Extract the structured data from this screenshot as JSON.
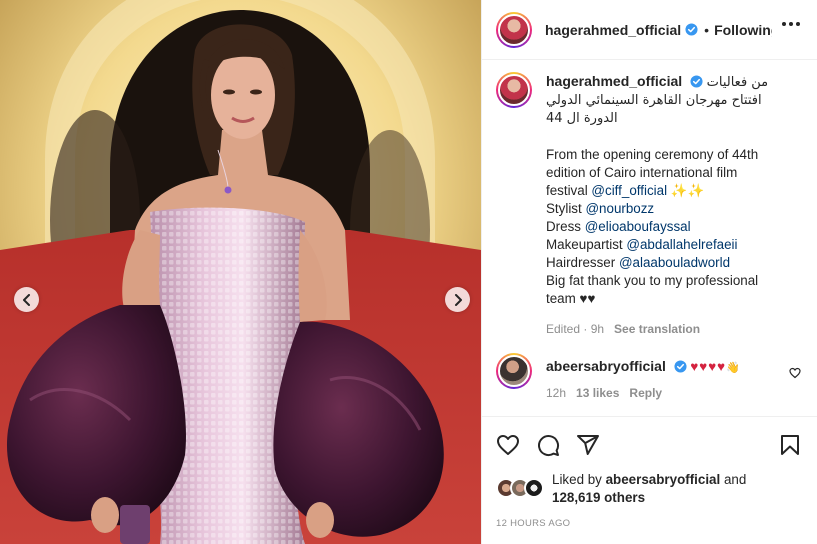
{
  "header": {
    "username": "hagerahmed_official",
    "separator": "•",
    "follow_status": "Following"
  },
  "caption": {
    "username": "hagerahmed_official",
    "arabic_lines": [
      "من فعاليات",
      "افتتاح مهرجان القاهرة السينمائي الدولي",
      "الدورة ال 44"
    ],
    "english_intro": [
      "From the opening ceremony of 44th",
      "edition of Cairo international film",
      "festival"
    ],
    "festival_mention": "@ciff_official",
    "sparkles": "✨✨",
    "credits": [
      {
        "label": "Stylist",
        "handle": "@nourbozz"
      },
      {
        "label": "Dress",
        "handle": "@elioaboufayssal"
      },
      {
        "label": "Makeupartist",
        "handle": "@abdallahelrefaeii"
      },
      {
        "label": "Hairdresser",
        "handle": "@alaabouladworld"
      }
    ],
    "thanks": [
      "Big fat thank you to my professional",
      "team ♥♥"
    ],
    "edited": "Edited · 9h",
    "see_translation": "See translation"
  },
  "comment": {
    "username": "abeersabryofficial",
    "text": "♥♥♥♥",
    "wave": "👋",
    "age": "12h",
    "likes": "13 likes",
    "reply": "Reply"
  },
  "likes": {
    "prefix": "Liked by",
    "user": "abeersabryofficial",
    "and": "and",
    "others": "128,619 others"
  },
  "timestamp": "12 HOURS AGO",
  "colors": {
    "link": "#00376b",
    "verified": "#3897f0",
    "muted": "#8e8e8e",
    "heart": "#d4233f"
  }
}
